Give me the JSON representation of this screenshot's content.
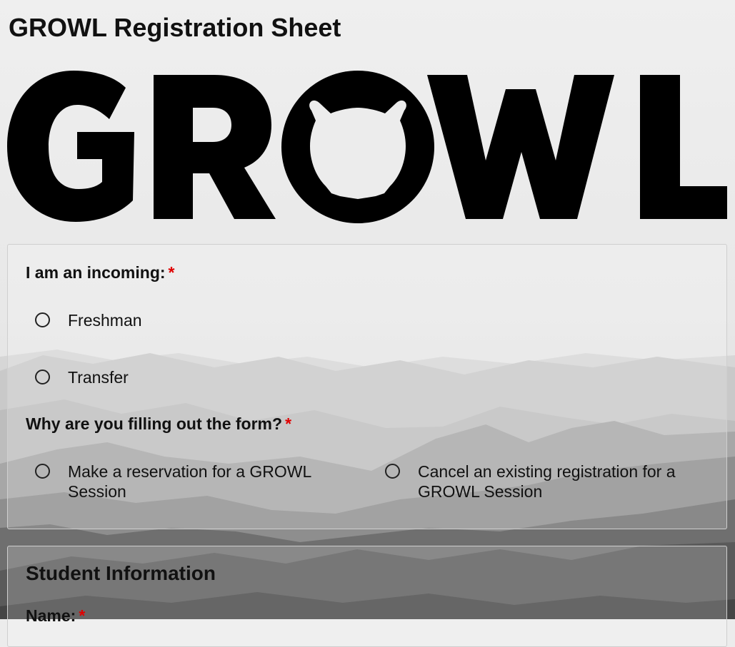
{
  "page": {
    "title": "GROWL Registration Sheet"
  },
  "logo": {
    "text": "GROWL"
  },
  "form": {
    "q1": {
      "label": "I am an incoming:",
      "required_mark": "*",
      "options": [
        "Freshman",
        "Transfer"
      ]
    },
    "q2": {
      "label": "Why are you filling out the form?",
      "required_mark": "*",
      "options": [
        "Make a reservation for a GROWL Session",
        "Cancel an existing registration for a GROWL Session"
      ]
    }
  },
  "student_info": {
    "heading": "Student Information",
    "name_label": "Name:",
    "required_mark": "*"
  },
  "colors": {
    "required": "#e00000",
    "text": "#111111",
    "card_border": "#cfcfcf"
  }
}
